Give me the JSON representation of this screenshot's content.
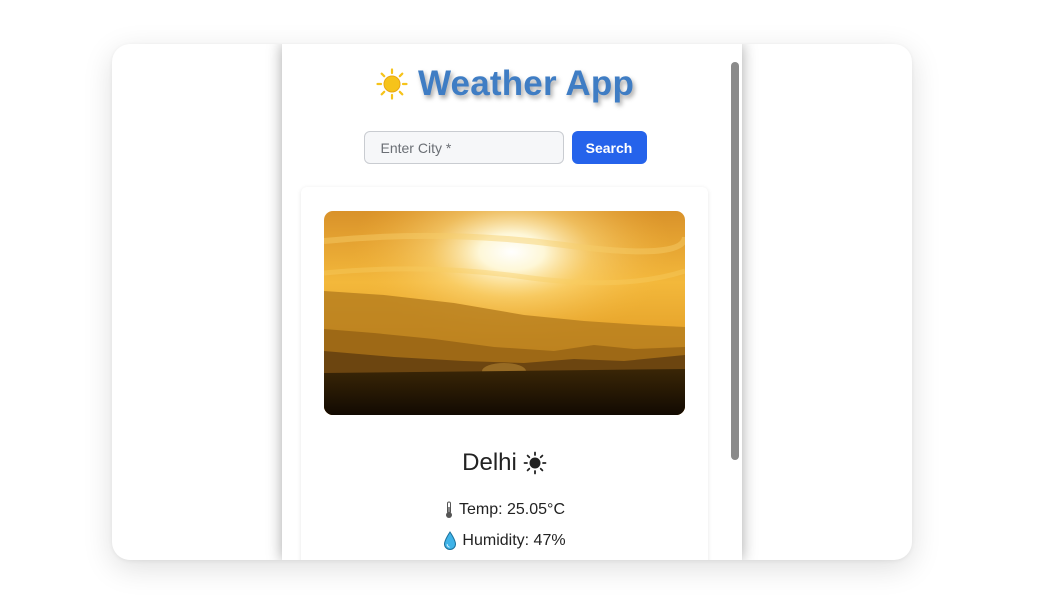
{
  "app": {
    "title": "Weather App",
    "logo_icon": "sun-icon"
  },
  "search": {
    "placeholder": "Enter City *",
    "value": "",
    "button_label": "Search"
  },
  "weather": {
    "city": "Delhi",
    "condition_icon": "clear-sun-icon",
    "temp_label": "Temp: 25.05°C",
    "humidity_label": "Humidity: 47%",
    "temp_icon": "thermometer-icon",
    "humidity_icon": "droplet-icon",
    "image_description": "sunset over hills"
  },
  "colors": {
    "title": "#3f7dc4",
    "accent_button": "#2563eb",
    "logo_sun": "#f6c31a"
  }
}
